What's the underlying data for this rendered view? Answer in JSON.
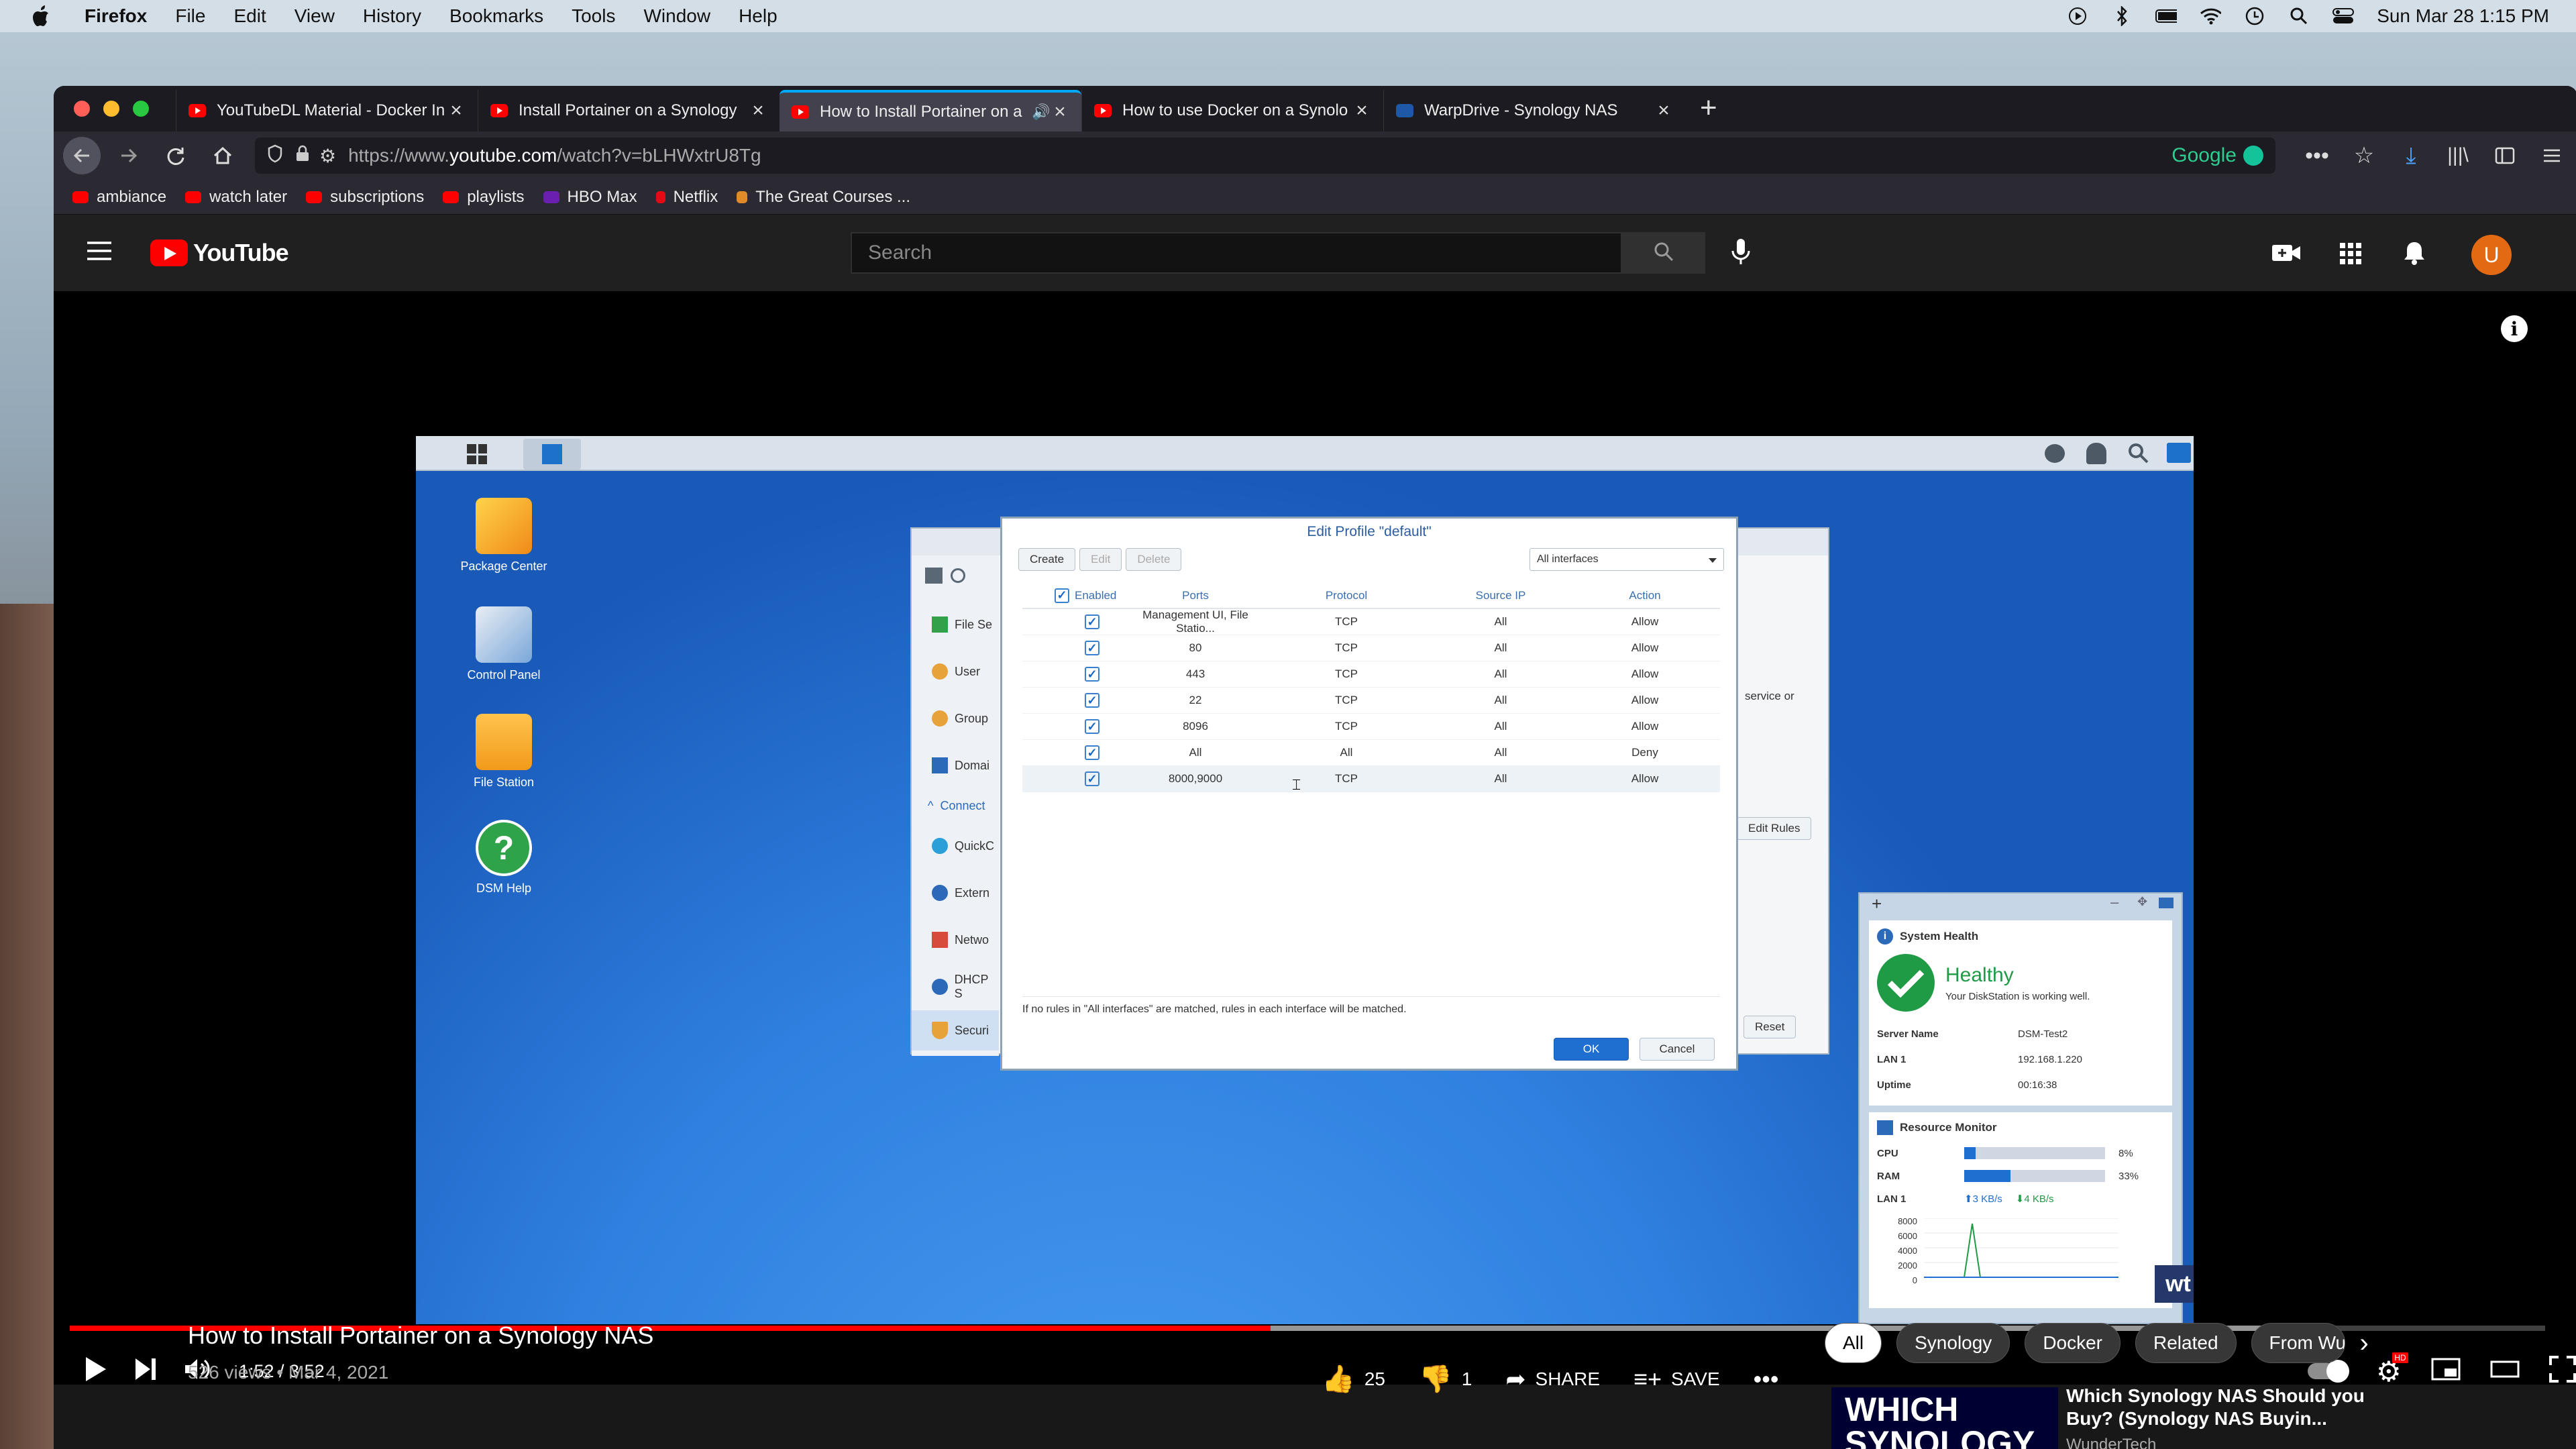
{
  "menubar": {
    "app": "Firefox",
    "menus": [
      "File",
      "Edit",
      "View",
      "History",
      "Bookmarks",
      "Tools",
      "Window",
      "Help"
    ],
    "clock": "Sun Mar 28  1:15 PM"
  },
  "browser": {
    "tabs": [
      {
        "label": "YouTubeDL Material - Docker In"
      },
      {
        "label": "Install Portainer on a Synology"
      },
      {
        "label": "How to Install Portainer on a"
      },
      {
        "label": "How to use Docker on a Synolo"
      },
      {
        "label": "WarpDrive - Synology NAS"
      }
    ],
    "url_prefix": "https://www.",
    "url_host": "youtube.com",
    "url_path": "/watch?v=bLHWxtrU8Tg",
    "search_engine": "Google",
    "bookmarks": [
      "ambiance",
      "watch later",
      "subscriptions",
      "playlists",
      "HBO Max",
      "Netflix",
      "The Great Courses ..."
    ]
  },
  "youtube": {
    "logo": "YouTube",
    "search_placeholder": "Search",
    "avatar_letter": "U",
    "time": "1:52 / 3:52",
    "progress_fraction": 0.485,
    "buffered_fraction": 0.91,
    "title": "How to Install Portainer on a Synology NAS",
    "meta": "526 views • Mar 4, 2021",
    "likes": "25",
    "dislikes": "1",
    "share": "SHARE",
    "save": "SAVE",
    "chips": [
      "All",
      "Synology",
      "Docker",
      "Related",
      "From Wu"
    ],
    "rec_thumb": "WHICH SYNOLOGY NAS",
    "rec_title": "Which Synology NAS Should you Buy? (Synology NAS Buyin...",
    "rec_channel": "WunderTech",
    "watermark": "wt"
  },
  "dsm": {
    "desktop_icons": [
      "Package Center",
      "Control Panel",
      "File Station",
      "DSM Help"
    ],
    "side_items": [
      "File Se",
      "User",
      "Group",
      "Domai",
      "Connect",
      "QuickC",
      "Extern",
      "Netwo",
      "DHCP S",
      "Securi"
    ],
    "bg_text": "service or",
    "edit_rules": "Edit Rules",
    "reset": "Reset",
    "dialog": {
      "title": "Edit Profile \"default\"",
      "buttons": [
        "Create",
        "Edit",
        "Delete"
      ],
      "interface": "All interfaces",
      "headers": [
        "Enabled",
        "Ports",
        "Protocol",
        "Source IP",
        "Action"
      ],
      "rows": [
        [
          "Management UI, File Statio...",
          "TCP",
          "All",
          "Allow"
        ],
        [
          "80",
          "TCP",
          "All",
          "Allow"
        ],
        [
          "443",
          "TCP",
          "All",
          "Allow"
        ],
        [
          "22",
          "TCP",
          "All",
          "Allow"
        ],
        [
          "8096",
          "TCP",
          "All",
          "Allow"
        ],
        [
          "All",
          "All",
          "All",
          "Deny"
        ],
        [
          "8000,9000",
          "TCP",
          "All",
          "Allow"
        ]
      ],
      "note": "If no rules in \"All interfaces\" are matched, rules in each interface will be matched.",
      "ok": "OK",
      "cancel": "Cancel"
    },
    "health": {
      "heading": "System Health",
      "status": "Healthy",
      "sub": "Your DiskStation is working well.",
      "server_label": "Server Name",
      "server": "DSM-Test2",
      "lan_label": "LAN 1",
      "lan": "192.168.1.220",
      "uptime_label": "Uptime",
      "uptime": "00:16:38"
    },
    "monitor": {
      "heading": "Resource Monitor",
      "cpu_label": "CPU",
      "cpu": "8%",
      "cpu_fraction": 0.08,
      "ram_label": "RAM",
      "ram": "33%",
      "ram_fraction": 0.33,
      "lan_label": "LAN 1",
      "up": "3 KB/s",
      "down": "4 KB/s",
      "yticks": [
        "8000",
        "6000",
        "4000",
        "2000",
        "0"
      ]
    }
  }
}
